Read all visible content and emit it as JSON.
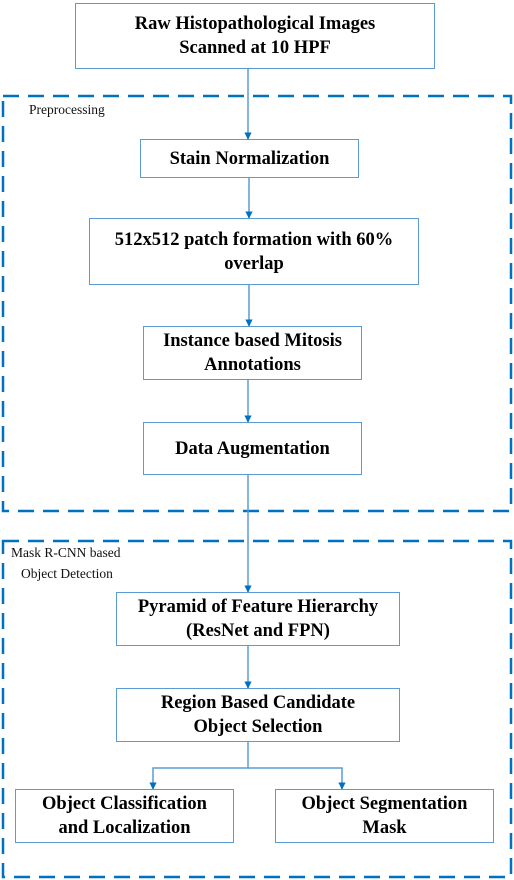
{
  "colors": {
    "box_border": "#5B9BD5",
    "arrow": "#0070C0",
    "group_border": "#0070C0",
    "text": "#000000"
  },
  "nodes": {
    "raw_images": "Raw Histopathological Images\nScanned at 10 HPF",
    "stain_normalization": "Stain Normalization",
    "patch_formation": "512x512 patch formation with 60%\noverlap",
    "instance_annotations": "Instance based Mitosis\nAnnotations",
    "data_augmentation": "Data Augmentation",
    "feature_pyramid": "Pyramid of Feature Hierarchy\n(ResNet and FPN)",
    "region_selection": "Region Based Candidate\nObject Selection",
    "classification_localization": "Object Classification\nand Localization",
    "segmentation_mask": "Object Segmentation\nMask"
  },
  "groups": {
    "preprocessing": "Preprocessing",
    "mask_rcnn_line1": "Mask R-CNN based",
    "mask_rcnn_line2": "Object Detection"
  },
  "edges": [
    [
      "raw_images",
      "stain_normalization"
    ],
    [
      "stain_normalization",
      "patch_formation"
    ],
    [
      "patch_formation",
      "instance_annotations"
    ],
    [
      "instance_annotations",
      "data_augmentation"
    ],
    [
      "data_augmentation",
      "feature_pyramid"
    ],
    [
      "feature_pyramid",
      "region_selection"
    ],
    [
      "region_selection",
      "classification_localization"
    ],
    [
      "region_selection",
      "segmentation_mask"
    ]
  ]
}
